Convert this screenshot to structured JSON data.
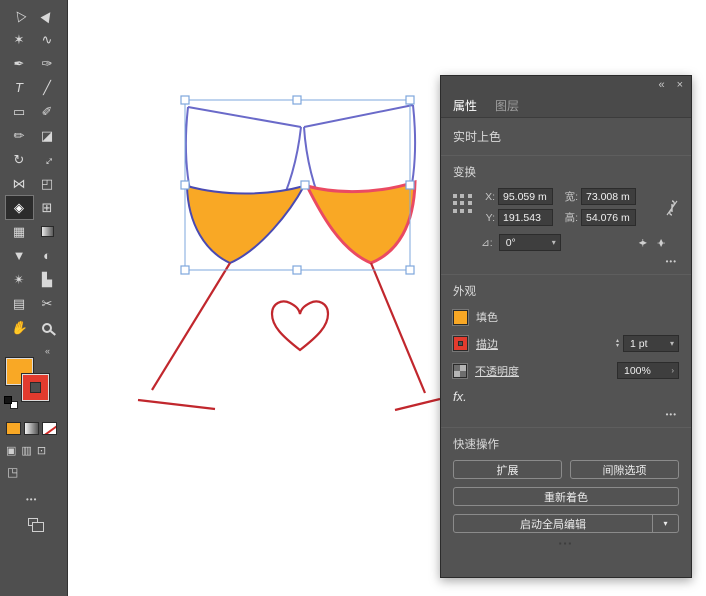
{
  "glyphs": {
    "collapse": "«",
    "close": "×",
    "chevron_down": "▾",
    "chevron_up": "▴",
    "submenu": "›",
    "more": "•••",
    "flip_h": "◂|▸"
  },
  "colors": {
    "fill": "#F9A825",
    "stroke_red": "#E23B2E",
    "artwork_outline": "#6A6AC9",
    "liquid_outline_left": "#4A4AB2",
    "liquid_outline_right": "#EA4A62",
    "heart_red": "#C1272D",
    "selection_blue": "#7EA7DC",
    "panel_bg": "#535353",
    "canvas": "#FFFFFF"
  },
  "toolbar": {
    "tools": [
      {
        "name": "selection",
        "glyph": "▷"
      },
      {
        "name": "direct-selection",
        "glyph": "▶"
      },
      {
        "name": "magic-wand",
        "glyph": "✶"
      },
      {
        "name": "lasso",
        "glyph": "∿"
      },
      {
        "name": "pen",
        "glyph": "✒"
      },
      {
        "name": "curvature",
        "glyph": "✑"
      },
      {
        "name": "type",
        "glyph": "T"
      },
      {
        "name": "line-segment",
        "glyph": "╱"
      },
      {
        "name": "rectangle",
        "glyph": "▭"
      },
      {
        "name": "paintbrush",
        "glyph": "✐"
      },
      {
        "name": "pencil",
        "glyph": "✏"
      },
      {
        "name": "eraser",
        "glyph": "◪"
      },
      {
        "name": "rotate",
        "glyph": "↻"
      },
      {
        "name": "scale",
        "glyph": "↔"
      },
      {
        "name": "width",
        "glyph": "⋈"
      },
      {
        "name": "free-transform",
        "glyph": "◰"
      },
      {
        "name": "live-paint-bucket",
        "glyph": "◈"
      },
      {
        "name": "perspective-grid",
        "glyph": "⊞"
      },
      {
        "name": "mesh",
        "glyph": "▦"
      },
      {
        "name": "gradient",
        "glyph": ""
      },
      {
        "name": "eyedropper",
        "glyph": "▼"
      },
      {
        "name": "blend",
        "glyph": "◐"
      },
      {
        "name": "symbol-sprayer",
        "glyph": "✴"
      },
      {
        "name": "column-graph",
        "glyph": "▙"
      },
      {
        "name": "artboard",
        "glyph": "▤"
      },
      {
        "name": "slice",
        "glyph": "✂"
      },
      {
        "name": "hand",
        "glyph": "✋"
      },
      {
        "name": "zoom",
        "glyph": ""
      }
    ],
    "selected_tool": "live-paint-bucket",
    "drawing_modes": [
      {
        "name": "draw-normal",
        "glyph": "▣"
      },
      {
        "name": "draw-behind",
        "glyph": "▥"
      },
      {
        "name": "draw-inside",
        "glyph": "⊡"
      }
    ],
    "screen_mode_glyph": "◳"
  },
  "panel": {
    "tabs": [
      {
        "label": "属性",
        "active": true
      },
      {
        "label": "图层",
        "active": false
      }
    ],
    "context_label": "实时上色",
    "transform": {
      "title": "变换",
      "x_label": "X:",
      "x_value": "95.059 m",
      "y_label": "Y:",
      "y_value": "191.543",
      "w_label": "宽:",
      "w_value": "73.008 m",
      "h_label": "高:",
      "h_value": "54.076 m",
      "angle_label": "⊿:",
      "angle_value": "0°"
    },
    "appearance": {
      "title": "外观",
      "fill_label": "填色",
      "stroke_label": "描边",
      "stroke_weight": "1 pt",
      "opacity_label": "不透明度",
      "opacity_value": "100%",
      "fx_label": "fx."
    },
    "quick_actions": {
      "title": "快速操作",
      "expand_label": "扩展",
      "gap_options_label": "间隙选项",
      "recolor_label": "重新着色",
      "global_edit_label": "启动全局编辑"
    }
  }
}
